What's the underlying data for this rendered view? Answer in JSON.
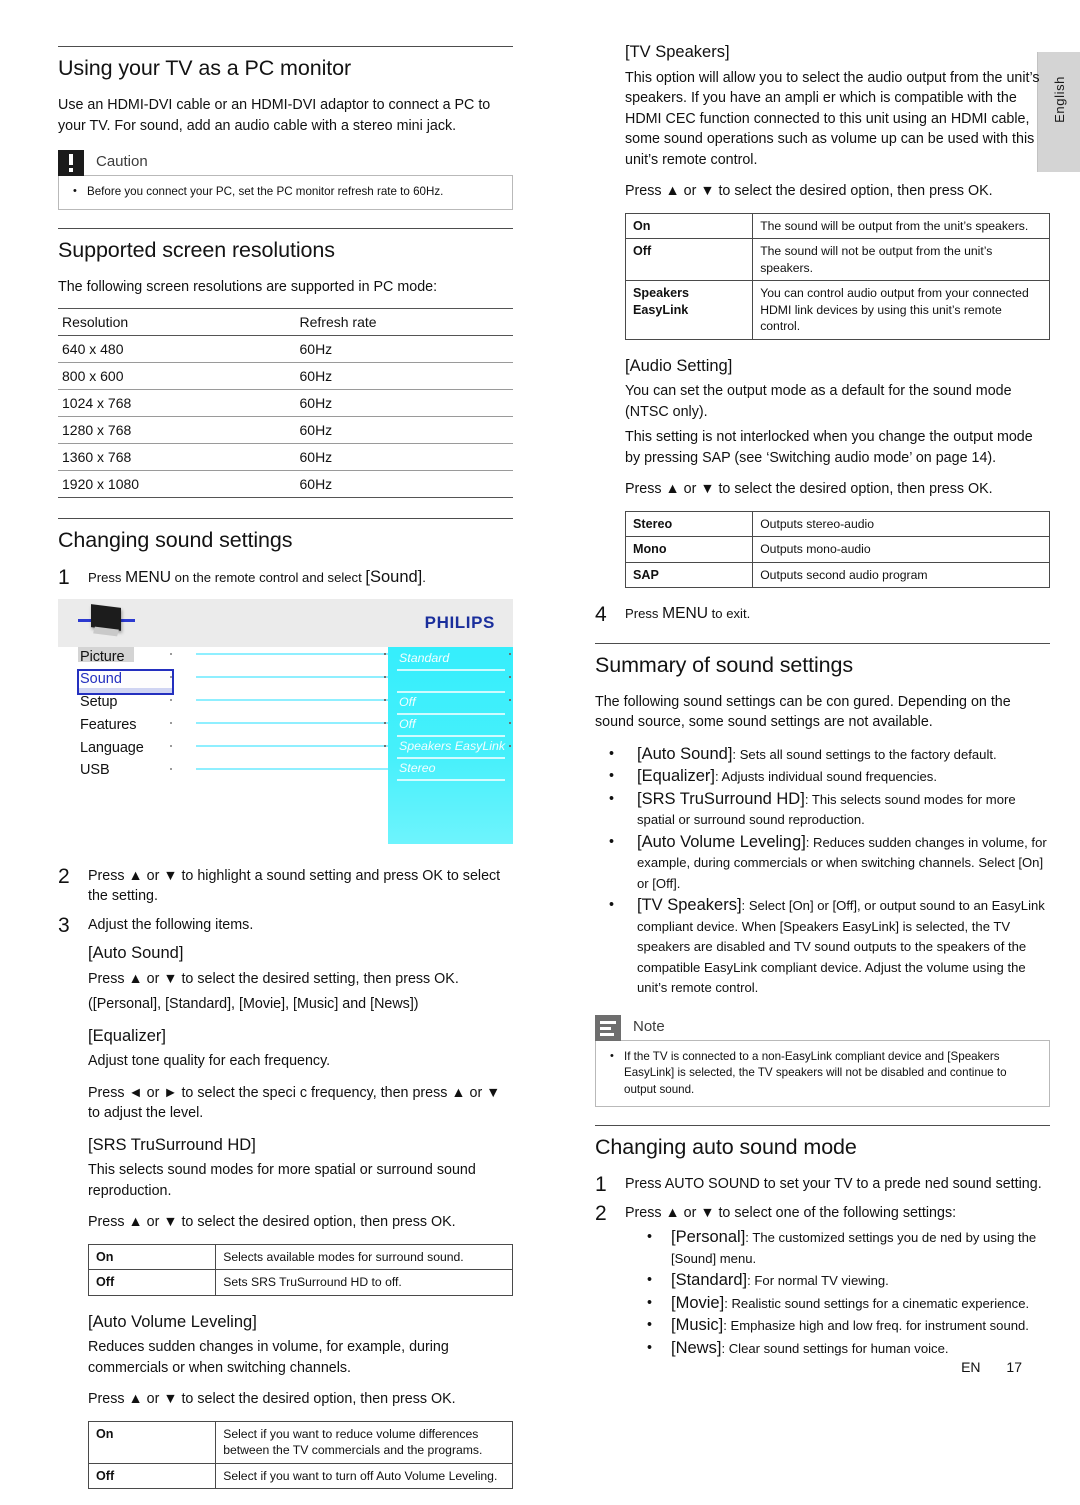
{
  "language_tab": {
    "label": "English"
  },
  "footer": {
    "lang_code": "EN",
    "page_number": "17"
  },
  "left": {
    "pc_monitor": {
      "heading": "Using your TV as a PC monitor",
      "body": "Use an HDMI-DVI cable or an HDMI-DVI adaptor to connect a PC to your TV. For sound, add an audio cable with a stereo mini jack.",
      "caution": {
        "label": "Caution",
        "items": [
          "Before you connect your PC, set the PC monitor refresh rate to 60Hz."
        ]
      }
    },
    "resolutions": {
      "heading": "Supported screen resolutions",
      "intro": "The following screen resolutions are supported in PC mode:",
      "columns": [
        "Resolution",
        "Refresh rate"
      ],
      "rows": [
        [
          "640 x 480",
          "60Hz"
        ],
        [
          "800 x 600",
          "60Hz"
        ],
        [
          "1024 x 768",
          "60Hz"
        ],
        [
          "1280 x 768",
          "60Hz"
        ],
        [
          "1360 x 768",
          "60Hz"
        ],
        [
          "1920 x 1080",
          "60Hz"
        ]
      ]
    },
    "changing_sound": {
      "heading": "Changing sound settings",
      "step1_num": "1",
      "step1_pre": "Press ",
      "step1_key": "MENU",
      "step1_mid": " on the remote control and select ",
      "step1_bracket": "[Sound]",
      "step1_end": ".",
      "osd": {
        "brand": "PHILIPS",
        "menu_items": [
          "Picture",
          "Sound",
          "Setup",
          "Features",
          "Language",
          "USB"
        ],
        "selected_item": "Sound",
        "values": [
          "Standard",
          "Off",
          "Off",
          "Speakers EasyLink",
          "Stereo"
        ]
      },
      "step2_num": "2",
      "step2_text": "Press ▲ or ▼ to highlight a sound setting and press OK to select the setting.",
      "step3_num": "3",
      "step3_text": "Adjust the following items.",
      "auto_sound": {
        "title": "[Auto Sound]",
        "line1": "Press ▲ or ▼ to select the desired setting, then press OK.",
        "line2": "([Personal], [Standard], [Movie], [Music] and [News])"
      },
      "equalizer": {
        "title": "[Equalizer]",
        "line1": "Adjust tone quality for each frequency.",
        "line2": "Press ◄ or ► to select the speci c frequency, then press ▲ or ▼ to adjust the level."
      },
      "srs": {
        "title": "[SRS TruSurround HD]",
        "line1": "This selects sound modes for more spatial or surround sound reproduction.",
        "line2": "Press ▲ or ▼ to select the desired option, then press OK.",
        "table": [
          [
            "On",
            "Selects available modes for surround sound."
          ],
          [
            "Off",
            "Sets SRS TruSurround HD to off."
          ]
        ]
      },
      "avl": {
        "title": "[Auto Volume Leveling]",
        "line1": "Reduces sudden changes in volume, for example, during commercials or when switching channels.",
        "line2": "Press ▲ or ▼ to select the desired option, then press OK.",
        "table": [
          [
            "On",
            "Select if you want to reduce volume differences between the TV commercials and the programs."
          ],
          [
            "Off",
            "Select if you want to turn off Auto Volume Leveling."
          ]
        ]
      }
    }
  },
  "right": {
    "tv_speakers": {
      "title": "[TV Speakers]",
      "body": "This option will allow you to select the audio output from the unit’s speakers. If you have an ampli er which is compatible with the HDMI CEC function connected to this unit using an HDMI cable, some sound operations such as volume up can be used with this unit’s remote control.",
      "press": "Press ▲ or ▼ to select the desired option, then press OK.",
      "table": [
        [
          "On",
          "The sound will be output from the unit’s speakers."
        ],
        [
          "Off",
          "The sound will not be output from the unit’s speakers."
        ],
        [
          "Speakers\nEasyLink",
          "You can control audio output from your connected HDMI link devices by using this unit’s remote control."
        ]
      ]
    },
    "audio_setting": {
      "title": "[Audio Setting]",
      "body1": "You can set the output mode as a default for the sound mode (NTSC only).",
      "body2": "This setting is not interlocked when you change the output mode by pressing SAP (see ‘Switching audio mode’ on page 14).",
      "press": "Press ▲ or ▼ to select the desired option, then press OK.",
      "table": [
        [
          "Stereo",
          "Outputs stereo-audio"
        ],
        [
          "Mono",
          "Outputs mono-audio"
        ],
        [
          "SAP",
          "Outputs second audio program"
        ]
      ]
    },
    "step4": {
      "num": "4",
      "pre": "Press ",
      "key": "MENU",
      "post": " to exit."
    },
    "summary": {
      "heading": "Summary of sound settings",
      "intro": "The following sound settings can be con gured. Depending on the sound source, some sound settings are not available.",
      "bullets": [
        {
          "term": "[Auto Sound]",
          "desc": ": Sets all sound settings to the factory default."
        },
        {
          "term": "[Equalizer]",
          "desc": ": Adjusts individual sound frequencies."
        },
        {
          "term": "[SRS TruSurround HD]",
          "desc": ": This selects sound modes for more spatial or surround sound reproduction."
        },
        {
          "term": "[Auto Volume Leveling]",
          "desc": ": Reduces sudden changes in volume, for example, during commercials or when switching channels. Select [On] or [Off]."
        },
        {
          "term": "[TV Speakers]",
          "desc": ": Select [On] or [Off], or output sound to an EasyLink compliant device. When [Speakers EasyLink] is selected, the TV speakers are disabled and TV sound outputs to the speakers of the compatible EasyLink compliant device. Adjust the volume using the unit’s remote control."
        }
      ],
      "note": {
        "label": "Note",
        "items": [
          "If the TV is connected to a non-EasyLink compliant device and [Speakers EasyLink] is selected, the TV speakers will not be disabled and continue to output sound."
        ]
      }
    },
    "auto_sound_mode": {
      "heading": "Changing auto sound mode",
      "step1_num": "1",
      "step1_text": "Press AUTO SOUND to set your TV to a prede ned sound setting.",
      "step2_num": "2",
      "step2_text": "Press ▲ or ▼ to select one of the following settings:",
      "bullets": [
        {
          "term": "[Personal]",
          "desc": ": The customized settings you de ned by using the [Sound] menu."
        },
        {
          "term": "[Standard]",
          "desc": ": For normal TV viewing."
        },
        {
          "term": "[Movie]",
          "desc": ": Realistic sound settings for a cinematic experience."
        },
        {
          "term": "[Music]",
          "desc": ": Emphasize high and low freq. for instrument sound."
        },
        {
          "term": "[News]",
          "desc": ": Clear sound settings for human voice."
        }
      ]
    }
  }
}
